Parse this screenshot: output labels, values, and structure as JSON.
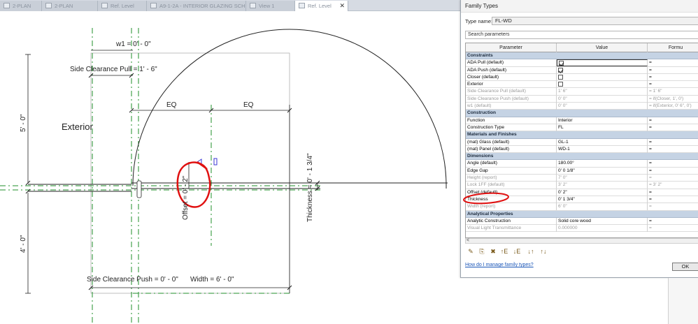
{
  "tabs": [
    {
      "label": "2-PLAN"
    },
    {
      "label": "2-PLAN"
    },
    {
      "label": "Ref. Level"
    },
    {
      "label": "A9-1-2A - INTERIOR GLAZING SCH..."
    },
    {
      "label": "View 1"
    },
    {
      "label": "Ref. Level",
      "close": "✕"
    }
  ],
  "drawing": {
    "w1_label": "w1 = 0' - 0\"",
    "side_clearance_pull": "Side Clearance Pull = 1' - 6\"",
    "eq_left": "EQ",
    "eq_right": "EQ",
    "exterior_label": "Exterior",
    "dim_5ft": "5' - 0\"",
    "dim_4ft": "4' - 0\"",
    "offset_label": "Offset = 0' - 2\"",
    "thickness_label": "Thickness = 0' - 1 3/4\"",
    "side_clearance_push": "Side Clearance Push = 0' - 0\"",
    "width_label": "Width = 6' - 0\"",
    "colors": {
      "ref_plane": "#1f8f2a",
      "dimension": "#222222",
      "markup": "#e01010",
      "handle": "#3b36d6"
    }
  },
  "dialog": {
    "title": "Family Types",
    "type_name_label": "Type name:",
    "type_name_value": "FL-WD",
    "search_placeholder": "Search parameters",
    "headers": {
      "parameter": "Parameter",
      "value": "Value",
      "formula": "Formu"
    },
    "rows": [
      {
        "kind": "section",
        "p": "Constraints"
      },
      {
        "p": "ADA Pull (default)",
        "cb": true,
        "f": "=",
        "sel": true
      },
      {
        "p": "ADA Push (default)",
        "cb": true,
        "f": "="
      },
      {
        "p": "Closer (default)",
        "cb": false,
        "f": "="
      },
      {
        "p": "Exterior",
        "cb": false,
        "f": "="
      },
      {
        "p": "Side Clearance Pull (default)",
        "v": "1' 6\"",
        "f": "= 1' 6\"",
        "grey": true
      },
      {
        "p": "Side Clearance Push (default)",
        "v": "0' 0\"",
        "f": "= if(Closer, 1', 0')",
        "grey": true
      },
      {
        "p": "w1 (default)",
        "v": "0' 0\"",
        "f": "= if(Exterior, 0' 6\", 0')",
        "grey": true
      },
      {
        "kind": "section",
        "p": "Construction"
      },
      {
        "p": "Function",
        "v": "Interior",
        "f": "="
      },
      {
        "p": "Construction Type",
        "v": "FL",
        "f": "="
      },
      {
        "kind": "section",
        "p": "Materials and Finishes"
      },
      {
        "p": "(mat) Glass (default)",
        "v": "GL-1",
        "f": "="
      },
      {
        "p": "(mat) Panel (default)",
        "v": "WD-1",
        "f": "="
      },
      {
        "kind": "section",
        "p": "Dimensions"
      },
      {
        "p": "Angle (default)",
        "v": "180.00°",
        "f": "="
      },
      {
        "p": "Edge Gap",
        "v": "0' 0 1/8\"",
        "f": "="
      },
      {
        "p": "Height (report)",
        "v": "7' 0\"",
        "f": "=",
        "grey": true
      },
      {
        "p": "Lock 1FF (default)",
        "v": "3' 2\"",
        "f": "= 3' 2\"",
        "grey": true
      },
      {
        "p": "Offset (default)",
        "v": "0' 2\"",
        "f": "="
      },
      {
        "p": "Thickness",
        "v": "0' 1 3/4\"",
        "f": "="
      },
      {
        "p": "Width (report)",
        "v": "6' 0\"",
        "f": "=",
        "grey": true
      },
      {
        "kind": "section",
        "p": "Analytical Properties"
      },
      {
        "p": "Analytic Construction",
        "v": "Solid core wood",
        "f": "="
      },
      {
        "p": "Visual Light Transmittance",
        "v": "0.000000",
        "f": "=",
        "grey": true
      }
    ],
    "scroll_arrow": "<",
    "toolbar_icons": [
      "pencil-icon",
      "new-type-icon",
      "delete-type-icon",
      "move-up-icon",
      "move-down-icon",
      "sort-ascending-icon",
      "sort-descending-icon"
    ],
    "toolbar_glyphs": [
      "✎",
      "⎘",
      "✖",
      "↑E",
      "↓E",
      "↓↑",
      "↑↓"
    ],
    "help_link": "How do I manage family types?",
    "ok_label": "OK"
  }
}
